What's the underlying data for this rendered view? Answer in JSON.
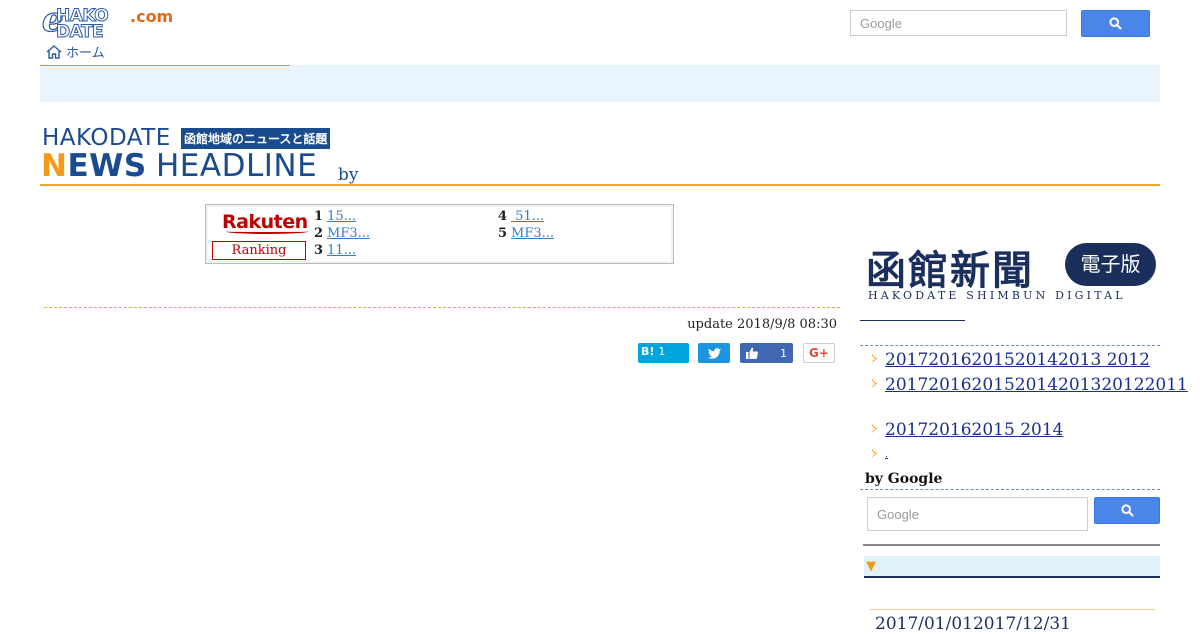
{
  "header": {
    "logo": {
      "e": "e",
      "hako": "HAKO",
      "date": "DATE",
      "com": ".com"
    },
    "home_label": "ホーム",
    "search": {
      "placeholder": "Google"
    }
  },
  "banner": {
    "hakodate": "HAKODATE",
    "tagline": "函館地域のニュースと話題",
    "news_first": "N",
    "news_rest": "EWS",
    "headline": "HEADLINE",
    "by": "by"
  },
  "ranking": {
    "logo": "Rakuten",
    "button": "Ranking",
    "items": [
      {
        "rank": "1",
        "text": "15... "
      },
      {
        "rank": "2",
        "text": "MF3... "
      },
      {
        "rank": "3",
        "text": "11... "
      },
      {
        "rank": "4",
        "text": " 51... "
      },
      {
        "rank": "5",
        "text": "MF3... "
      }
    ],
    "more": "  "
  },
  "main": {
    "update": "update 2018/9/8 08:30",
    "share": {
      "hatena_label": "B!",
      "hatena_count": "1",
      "like_count": "1",
      "gplus_label": "G+"
    }
  },
  "sidebar": {
    "shimbun": {
      "kanji": "函館新聞",
      "edition": "電子版",
      "roman": "HAKODATE SHIMBUN DIGITAL"
    },
    "archives": [
      {
        "text": "  20172016201520142013 2012"
      },
      {
        "text": "     2017201620152014201320122011"
      },
      {
        "text": "  201720162015 2014"
      },
      {
        "text": "."
      }
    ],
    "by_google": "by Google",
    "search": {
      "placeholder": "Google"
    },
    "period_marker": "▼",
    "period_range": "2017/01/012017/12/31"
  },
  "colors": {
    "brand_blue": "#1a4b8f",
    "accent_orange": "#f39a17",
    "rakuten_red": "#bf0000",
    "band_blue": "#e8f5fd"
  }
}
